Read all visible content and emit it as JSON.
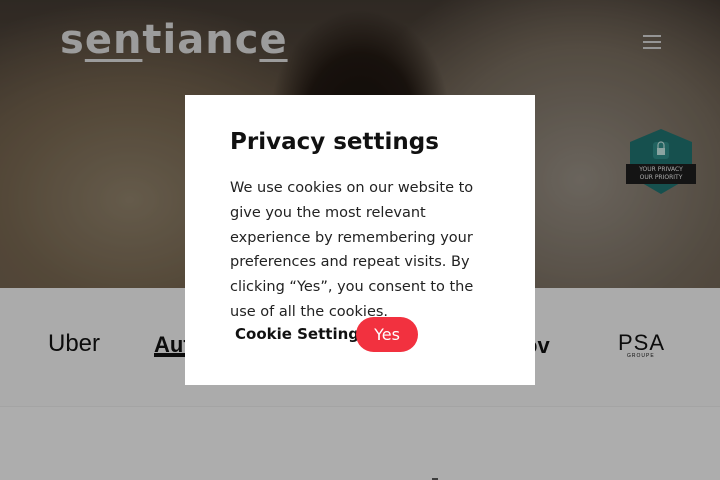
{
  "header": {
    "logo_part1": "s",
    "logo_part2": "en",
    "logo_part3": "tianc",
    "logo_part4": "e",
    "menu_icon": "hamburger-menu-icon"
  },
  "badge": {
    "icon": "lock-shield-icon",
    "line1": "YOUR PRIVACY",
    "line2": "OUR PRIORITY"
  },
  "clients": {
    "uber": "Uber",
    "aut": "Aut",
    "ov": "ōv",
    "psa": "PSA",
    "psa_sub": "GROUPE"
  },
  "cookie_modal": {
    "title": "Privacy settings",
    "body": "We use cookies on our website to give you the most relevant experience by remembering your preferences and repeat visits. By clicking “Yes”, you consent to the use of all the cookies.",
    "settings_label": "Cookie Settings",
    "accept_label": "Yes"
  },
  "colors": {
    "accent": "#f2313f",
    "badge": "#1f6f6c"
  }
}
